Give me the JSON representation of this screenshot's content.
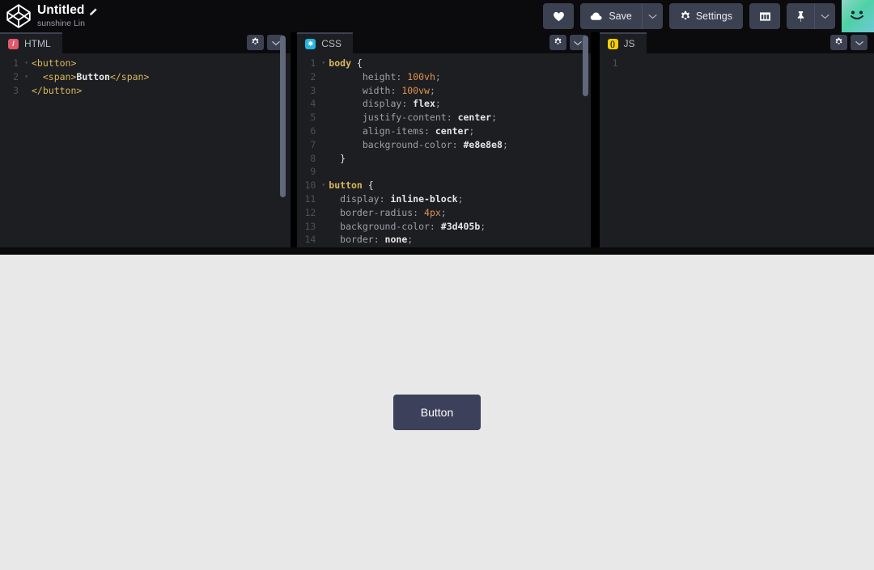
{
  "header": {
    "logo_icon": "codepen-logo-icon",
    "pen_title": "Untitled",
    "edit_icon": "pencil-icon",
    "author": "sunshine Lin",
    "buttons": {
      "love_label": "",
      "love_icon": "heart-icon",
      "save_label": "Save",
      "save_icon": "cloud-icon",
      "save_caret_icon": "chevron-down-icon",
      "settings_label": "Settings",
      "settings_icon": "gear-icon",
      "layout_label": "",
      "layout_icon": "layout-grid-icon",
      "pin_label": "",
      "pin_icon": "pin-icon",
      "pin_caret_icon": "chevron-down-icon"
    },
    "avatar_alt": "user-avatar"
  },
  "panes": [
    {
      "id": "html",
      "label": "HTML",
      "icon_glyph": "/",
      "settings_icon": "gear-icon",
      "collapse_icon": "chevron-down-icon",
      "lines": [
        {
          "n": "1",
          "fold": "▾",
          "tokens": [
            {
              "c": "t-tag",
              "t": "<button>"
            }
          ]
        },
        {
          "n": "2",
          "fold": "▾",
          "tokens": [
            {
              "c": "t-tag",
              "t": "  <span>"
            },
            {
              "c": "t-txt",
              "t": "Button"
            },
            {
              "c": "t-tag",
              "t": "</span>"
            }
          ]
        },
        {
          "n": "3",
          "fold": "",
          "tokens": [
            {
              "c": "t-tag",
              "t": "</button>"
            }
          ]
        }
      ]
    },
    {
      "id": "css",
      "label": "CSS",
      "icon_glyph": "✷",
      "settings_icon": "gear-icon",
      "collapse_icon": "chevron-down-icon",
      "lines": [
        {
          "n": "1",
          "fold": "▾",
          "tokens": [
            {
              "c": "t-sel",
              "t": "body"
            },
            {
              "c": "t-brace",
              "t": " {"
            }
          ]
        },
        {
          "n": "2",
          "fold": "",
          "tokens": [
            {
              "c": "t-prop",
              "t": "      height"
            },
            {
              "c": "t-punc",
              "t": ": "
            },
            {
              "c": "t-num",
              "t": "100vh"
            },
            {
              "c": "t-punc",
              "t": ";"
            }
          ]
        },
        {
          "n": "3",
          "fold": "",
          "tokens": [
            {
              "c": "t-prop",
              "t": "      width"
            },
            {
              "c": "t-punc",
              "t": ": "
            },
            {
              "c": "t-num",
              "t": "100vw"
            },
            {
              "c": "t-punc",
              "t": ";"
            }
          ]
        },
        {
          "n": "4",
          "fold": "",
          "tokens": [
            {
              "c": "t-prop",
              "t": "      display"
            },
            {
              "c": "t-punc",
              "t": ": "
            },
            {
              "c": "t-val",
              "t": "flex"
            },
            {
              "c": "t-punc",
              "t": ";"
            }
          ]
        },
        {
          "n": "5",
          "fold": "",
          "tokens": [
            {
              "c": "t-prop",
              "t": "      justify-content"
            },
            {
              "c": "t-punc",
              "t": ": "
            },
            {
              "c": "t-val",
              "t": "center"
            },
            {
              "c": "t-punc",
              "t": ";"
            }
          ]
        },
        {
          "n": "6",
          "fold": "",
          "tokens": [
            {
              "c": "t-prop",
              "t": "      align-items"
            },
            {
              "c": "t-punc",
              "t": ": "
            },
            {
              "c": "t-val",
              "t": "center"
            },
            {
              "c": "t-punc",
              "t": ";"
            }
          ]
        },
        {
          "n": "7",
          "fold": "",
          "tokens": [
            {
              "c": "t-prop",
              "t": "      background-color"
            },
            {
              "c": "t-punc",
              "t": ": "
            },
            {
              "c": "t-val",
              "t": "#e8e8e8"
            },
            {
              "c": "t-punc",
              "t": ";"
            }
          ]
        },
        {
          "n": "8",
          "fold": "",
          "tokens": [
            {
              "c": "t-brace",
              "t": "  }"
            }
          ]
        },
        {
          "n": "9",
          "fold": "",
          "tokens": [
            {
              "c": "t-brace",
              "t": ""
            }
          ]
        },
        {
          "n": "10",
          "fold": "▾",
          "tokens": [
            {
              "c": "t-sel",
              "t": "button"
            },
            {
              "c": "t-brace",
              "t": " {"
            }
          ]
        },
        {
          "n": "11",
          "fold": "",
          "tokens": [
            {
              "c": "t-prop",
              "t": "  display"
            },
            {
              "c": "t-punc",
              "t": ": "
            },
            {
              "c": "t-val",
              "t": "inline-block"
            },
            {
              "c": "t-punc",
              "t": ";"
            }
          ]
        },
        {
          "n": "12",
          "fold": "",
          "tokens": [
            {
              "c": "t-prop",
              "t": "  border-radius"
            },
            {
              "c": "t-punc",
              "t": ": "
            },
            {
              "c": "t-num",
              "t": "4px"
            },
            {
              "c": "t-punc",
              "t": ";"
            }
          ]
        },
        {
          "n": "13",
          "fold": "",
          "tokens": [
            {
              "c": "t-prop",
              "t": "  background-color"
            },
            {
              "c": "t-punc",
              "t": ": "
            },
            {
              "c": "t-val",
              "t": "#3d405b"
            },
            {
              "c": "t-punc",
              "t": ";"
            }
          ]
        },
        {
          "n": "14",
          "fold": "",
          "tokens": [
            {
              "c": "t-prop",
              "t": "  border"
            },
            {
              "c": "t-punc",
              "t": ": "
            },
            {
              "c": "t-val",
              "t": "none"
            },
            {
              "c": "t-punc",
              "t": ";"
            }
          ]
        }
      ]
    },
    {
      "id": "js",
      "label": "JS",
      "icon_glyph": "()",
      "settings_icon": "gear-icon",
      "collapse_icon": "chevron-down-icon",
      "lines": [
        {
          "n": "1",
          "fold": "",
          "tokens": [
            {
              "c": "t-brace",
              "t": ""
            }
          ]
        }
      ]
    }
  ],
  "preview": {
    "button_label": "Button",
    "background_color": "#e8e8e8",
    "button_color": "#3d405b"
  }
}
